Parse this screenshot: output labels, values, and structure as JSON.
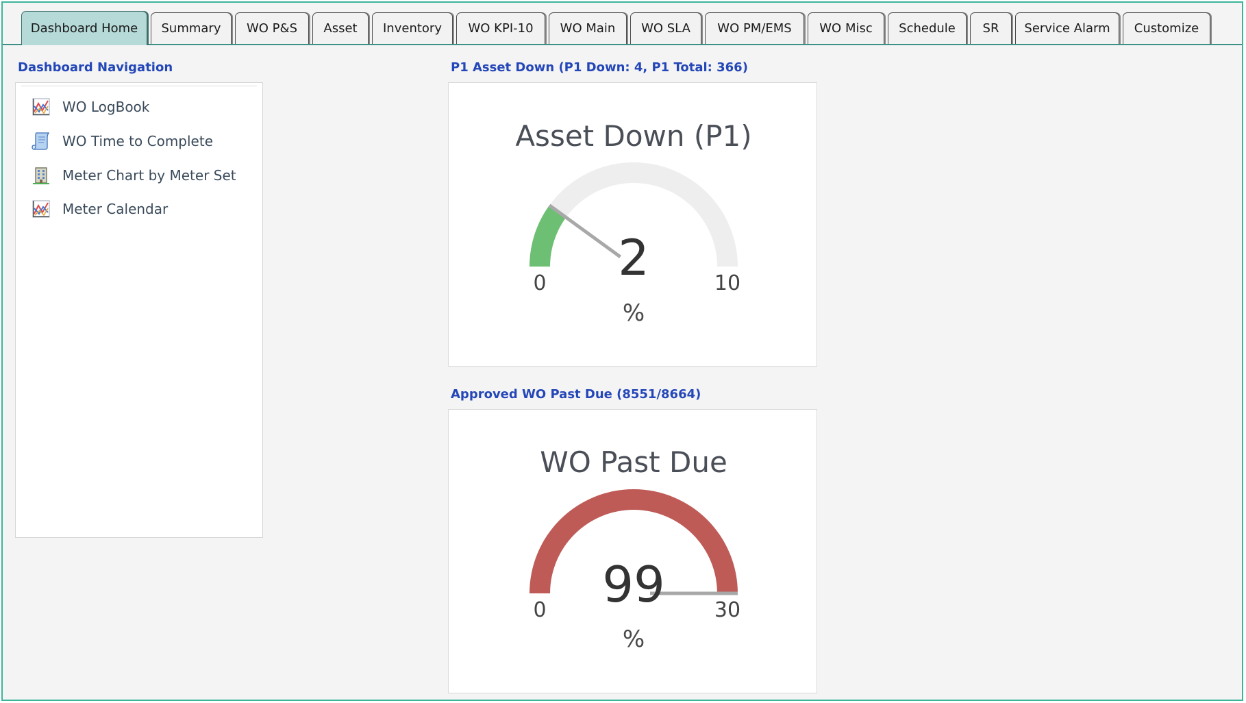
{
  "tabs": [
    {
      "label": "Dashboard Home",
      "active": true
    },
    {
      "label": "Summary"
    },
    {
      "label": "WO P&S"
    },
    {
      "label": "Asset"
    },
    {
      "label": "Inventory"
    },
    {
      "label": "WO KPI-10"
    },
    {
      "label": "WO Main"
    },
    {
      "label": "WO SLA"
    },
    {
      "label": "WO PM/EMS"
    },
    {
      "label": "WO Misc"
    },
    {
      "label": "Schedule"
    },
    {
      "label": "SR"
    },
    {
      "label": "Service Alarm"
    },
    {
      "label": "Customize"
    }
  ],
  "navigation": {
    "title": "Dashboard Navigation",
    "items": [
      {
        "label": "WO LogBook",
        "icon": "line-chart-icon"
      },
      {
        "label": "WO Time to Complete",
        "icon": "scroll-icon"
      },
      {
        "label": "Meter Chart by Meter Set",
        "icon": "building-icon"
      },
      {
        "label": "Meter Calendar",
        "icon": "line-chart-icon"
      }
    ]
  },
  "gauges": [
    {
      "section_title": "P1 Asset Down (P1 Down: 4, P1 Total: 366)",
      "title": "Asset Down (P1)",
      "value": 2,
      "value_label": "2",
      "unit": "%",
      "min": 0,
      "max": 10,
      "min_label": "0",
      "max_label": "10",
      "color": "#6cbf73",
      "track_color": "#eeeeee",
      "needle_color": "#a8a8a8"
    },
    {
      "section_title": "Approved WO Past Due (8551/8664)",
      "title": "WO Past Due",
      "value": 99,
      "value_label": "99",
      "unit": "%",
      "min": 0,
      "max": 30,
      "min_label": "0",
      "max_label": "30",
      "color": "#bf5b57",
      "track_color": "#eeeeee",
      "needle_color": "#a8a8a8"
    }
  ],
  "colors": {
    "accent_border": "#3cb49a",
    "section_title": "#2346b8",
    "active_tab": "#b5dad8"
  }
}
